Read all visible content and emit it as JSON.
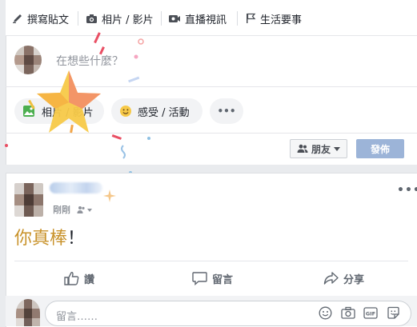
{
  "composer": {
    "tabs": [
      {
        "label": "撰寫貼文",
        "icon": "pencil-icon"
      },
      {
        "label": "相片 / 影片",
        "icon": "camera-icon"
      },
      {
        "label": "直播視訊",
        "icon": "video-camera-icon"
      },
      {
        "label": "生活要事",
        "icon": "flag-icon"
      }
    ],
    "placeholder": "在想些什麼？",
    "options": [
      {
        "label": "相片 / 影片",
        "icon": "photo-icon"
      },
      {
        "label": "感受 / 活動",
        "icon": "emoji-icon"
      },
      {
        "label": "•••",
        "icon": "more-icon"
      }
    ],
    "audience_label": "朋友",
    "post_label": "發佈"
  },
  "post": {
    "timestamp": "剛剛",
    "text_highlight": "你真棒",
    "text_rest": "！",
    "actions": [
      {
        "label": "讚",
        "icon": "like-icon"
      },
      {
        "label": "留言",
        "icon": "comment-icon"
      },
      {
        "label": "分享",
        "icon": "share-icon"
      }
    ],
    "comment_placeholder": "留言……",
    "more_label": "•••"
  },
  "colors": {
    "background": "#e9ebee",
    "primary_disabled": "#9cb4d8",
    "highlight_text": "#c8922a"
  }
}
